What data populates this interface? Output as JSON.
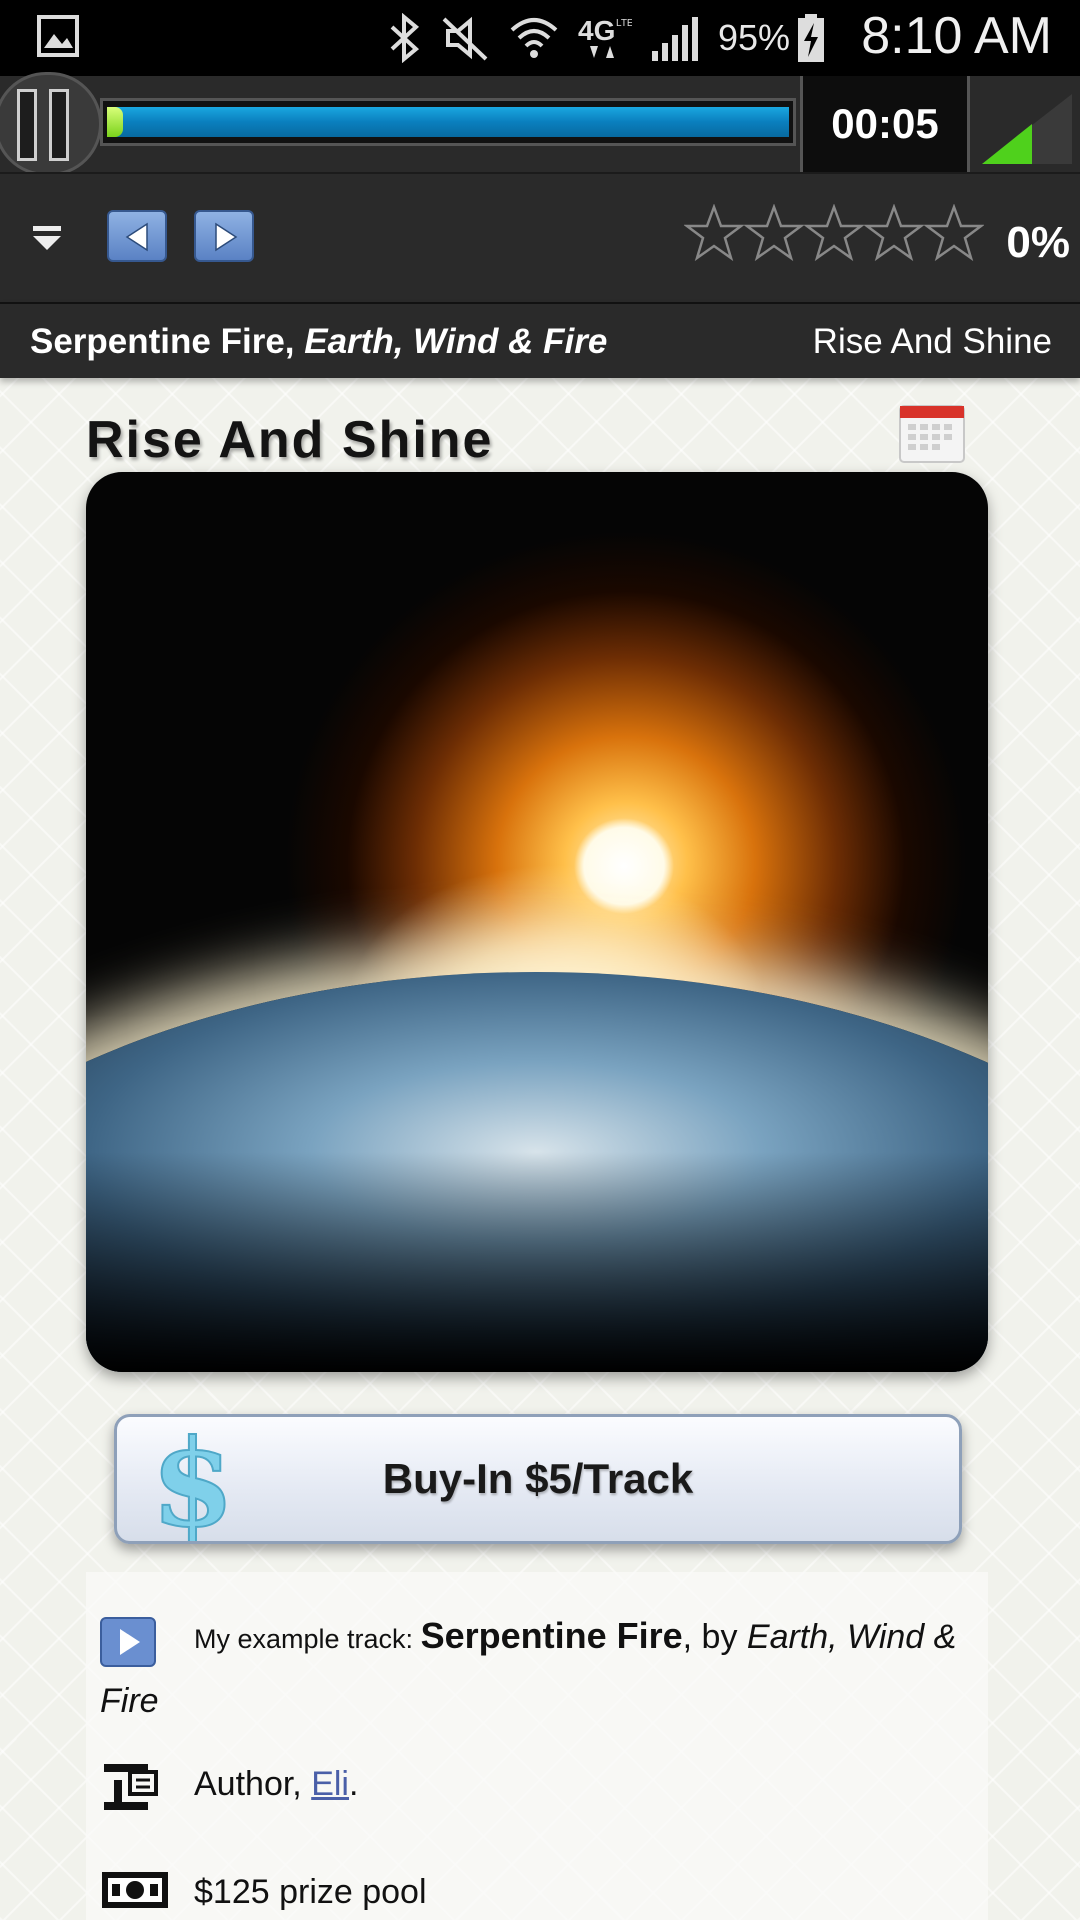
{
  "status_bar": {
    "battery": "95%",
    "time": "8:10 AM",
    "icons": [
      "gallery-icon",
      "bluetooth-icon",
      "mute-icon",
      "wifi-icon",
      "4g-lte-icon",
      "signal-icon",
      "battery-charging-icon"
    ]
  },
  "player": {
    "elapsed": "00:05",
    "progress_fraction": 0.01
  },
  "controls": {
    "rating_stars": 0,
    "rating_max": 5,
    "rating_percent": "0%"
  },
  "now_playing": {
    "track": "Serpentine Fire",
    "separator": ", ",
    "artist": "Earth, Wind & Fire",
    "playlist": "Rise And Shine"
  },
  "page": {
    "title": "Rise And Shine",
    "buy_label": "Buy-In $5/Track"
  },
  "info": {
    "track_prefix": "My example track: ",
    "track_name": "Serpentine Fire",
    "track_by": ", by ",
    "track_artist": "Earth, Wind & Fire",
    "author_prefix": "Author, ",
    "author_name": "Eli",
    "author_suffix": ".",
    "prize": "$125 prize pool"
  },
  "colors": {
    "bar_bg": "#2a2a2a",
    "progress": "#0a7fbe",
    "link": "#4a5fa8",
    "nav_button": "#5a82c4"
  }
}
